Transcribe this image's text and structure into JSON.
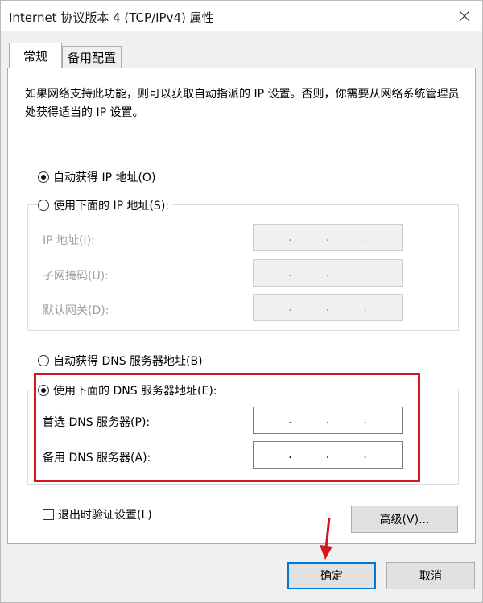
{
  "window": {
    "title": "Internet 协议版本 4 (TCP/IPv4) 属性",
    "close_glyph": "✕"
  },
  "tabs": [
    {
      "label": "常规",
      "active": true
    },
    {
      "label": "备用配置",
      "active": false
    }
  ],
  "description": "如果网络支持此功能，则可以获取自动指派的 IP 设置。否则，你需要从网络系统管理员处获得适当的 IP 设置。",
  "ip_section": {
    "auto_label": "自动获得 IP 地址(O)",
    "auto_checked": true,
    "manual_label": "使用下面的 IP 地址(S):",
    "manual_checked": false,
    "fields": [
      {
        "label": "IP 地址(I):",
        "value": ". . ."
      },
      {
        "label": "子网掩码(U):",
        "value": ". . ."
      },
      {
        "label": "默认网关(D):",
        "value": ". . ."
      }
    ]
  },
  "dns_section": {
    "auto_label": "自动获得 DNS 服务器地址(B)",
    "auto_checked": false,
    "manual_label": "使用下面的 DNS 服务器地址(E):",
    "manual_checked": true,
    "fields": [
      {
        "label": "首选 DNS 服务器(P):",
        "value": ". . ."
      },
      {
        "label": "备用 DNS 服务器(A):",
        "value": ". . ."
      }
    ]
  },
  "validate_label": "退出时验证设置(L)",
  "validate_checked": false,
  "buttons": {
    "advanced": "高级(V)...",
    "ok": "确定",
    "cancel": "取消"
  },
  "colors": {
    "highlight": "#d4161e",
    "dialog_bg": "#f0f0f0",
    "panel_bg": "#ffffff"
  }
}
